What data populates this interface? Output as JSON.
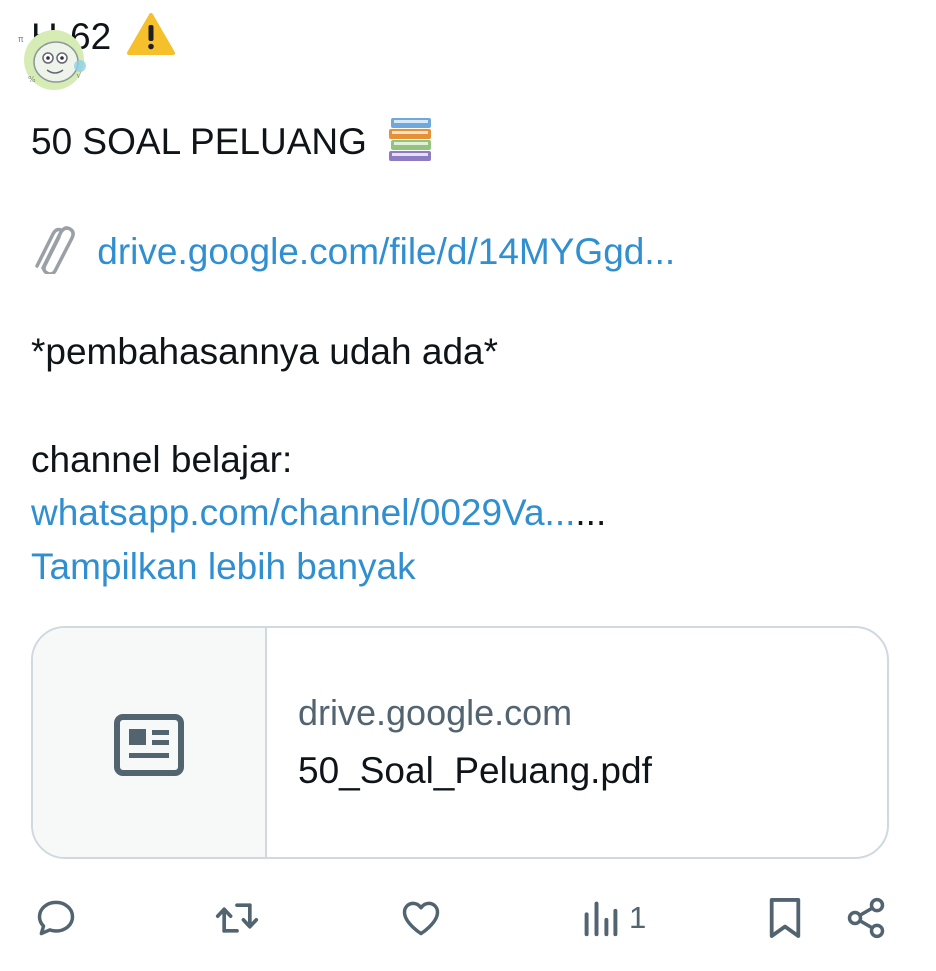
{
  "post": {
    "line1": "H-62",
    "line2": "50 SOAL PELUANG",
    "drive_link": "drive.google.com/file/d/14MYGgd...",
    "note": "*pembahasannya udah ada*",
    "channel_label": "channel belajar:",
    "channel_link": "whatsapp.com/channel/0029Va...",
    "channel_suffix": "...",
    "show_more": "Tampilkan lebih banyak"
  },
  "card": {
    "domain": "drive.google.com",
    "title": "50_Soal_Peluang.pdf"
  },
  "actions": {
    "views_count": "1"
  },
  "icons": [
    "warning-icon",
    "books-icon",
    "paperclip-icon",
    "article-icon",
    "reply-icon",
    "repost-icon",
    "like-icon",
    "views-icon",
    "bookmark-icon",
    "share-icon"
  ],
  "colors": {
    "link": "#2f8fd0",
    "muted": "#536471",
    "text": "#0f1419",
    "border": "#cfd9de"
  }
}
